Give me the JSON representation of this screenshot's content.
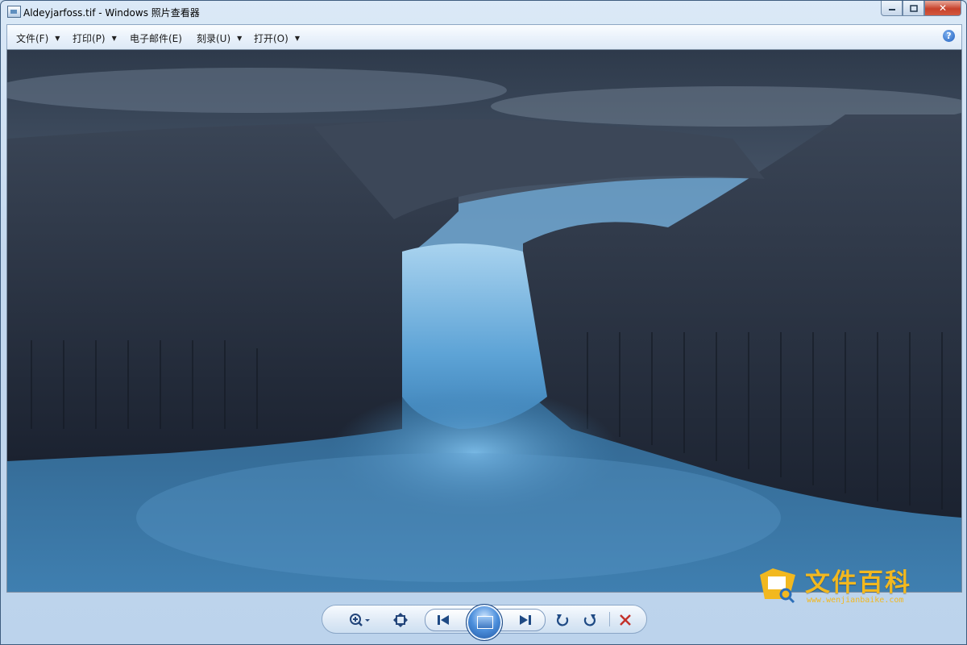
{
  "window": {
    "title": "Aldeyjarfoss.tif - Windows 照片查看器",
    "min_symbol": "▭",
    "max_symbol": "◻",
    "close_symbol": "✕"
  },
  "menu": {
    "file": "文件(F)",
    "print": "打印(P)",
    "email": "电子邮件(E)",
    "burn": "刻录(U)",
    "open": "打开(O)",
    "help_symbol": "?"
  },
  "image": {
    "description_colors": {
      "sky": "#3b4a5e",
      "rock": "#2a3546",
      "water": "#4f8fc0"
    }
  },
  "watermark": {
    "text": "文件百科",
    "url": "www.wenjianbaike.com",
    "color": "#f2b81f"
  },
  "toolbar": {
    "icons": [
      "zoom-icon",
      "fit-window-icon",
      "previous-icon",
      "slideshow-icon",
      "next-icon",
      "rotate-ccw-icon",
      "rotate-cw-icon",
      "delete-icon"
    ]
  }
}
